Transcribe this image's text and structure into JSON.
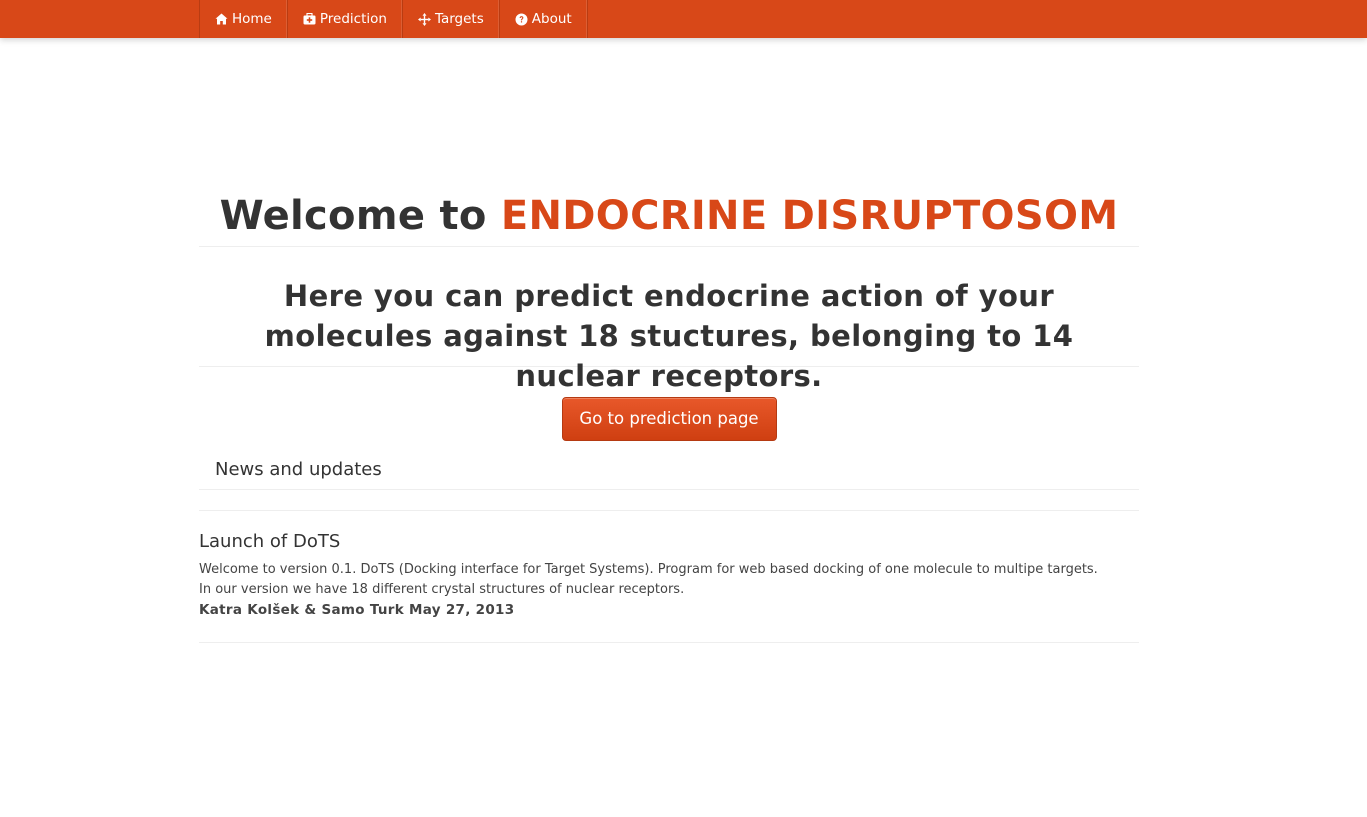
{
  "colors": {
    "brand": "#d84818",
    "navbar_bg": "#d84818",
    "text": "#333333",
    "button_bg": "#d84818"
  },
  "nav": {
    "items": [
      {
        "label": "Home",
        "icon": "home-icon"
      },
      {
        "label": "Prediction",
        "icon": "medkit-icon"
      },
      {
        "label": "Targets",
        "icon": "crosshairs-icon"
      },
      {
        "label": "About",
        "icon": "question-circle-icon"
      }
    ]
  },
  "hero": {
    "welcome_prefix": "Welcome to ",
    "brand_name": "ENDOCRINE DISRUPTOSOM",
    "subtitle": "Here you can predict endocrine action of your molecules against 18 stuctures, belonging to 14 nuclear receptors.",
    "cta_label": "Go to prediction page"
  },
  "news": {
    "heading": "News and updates",
    "articles": [
      {
        "title": "Launch of DoTS",
        "body": "Welcome to version 0.1. DoTS (Docking interface for Target Systems). Program for web based docking of one molecule to multipe targets. In our version we have 18 different crystal structures of nuclear receptors.",
        "byline": "Katra Kolšek & Samo Turk May 27, 2013"
      }
    ]
  }
}
